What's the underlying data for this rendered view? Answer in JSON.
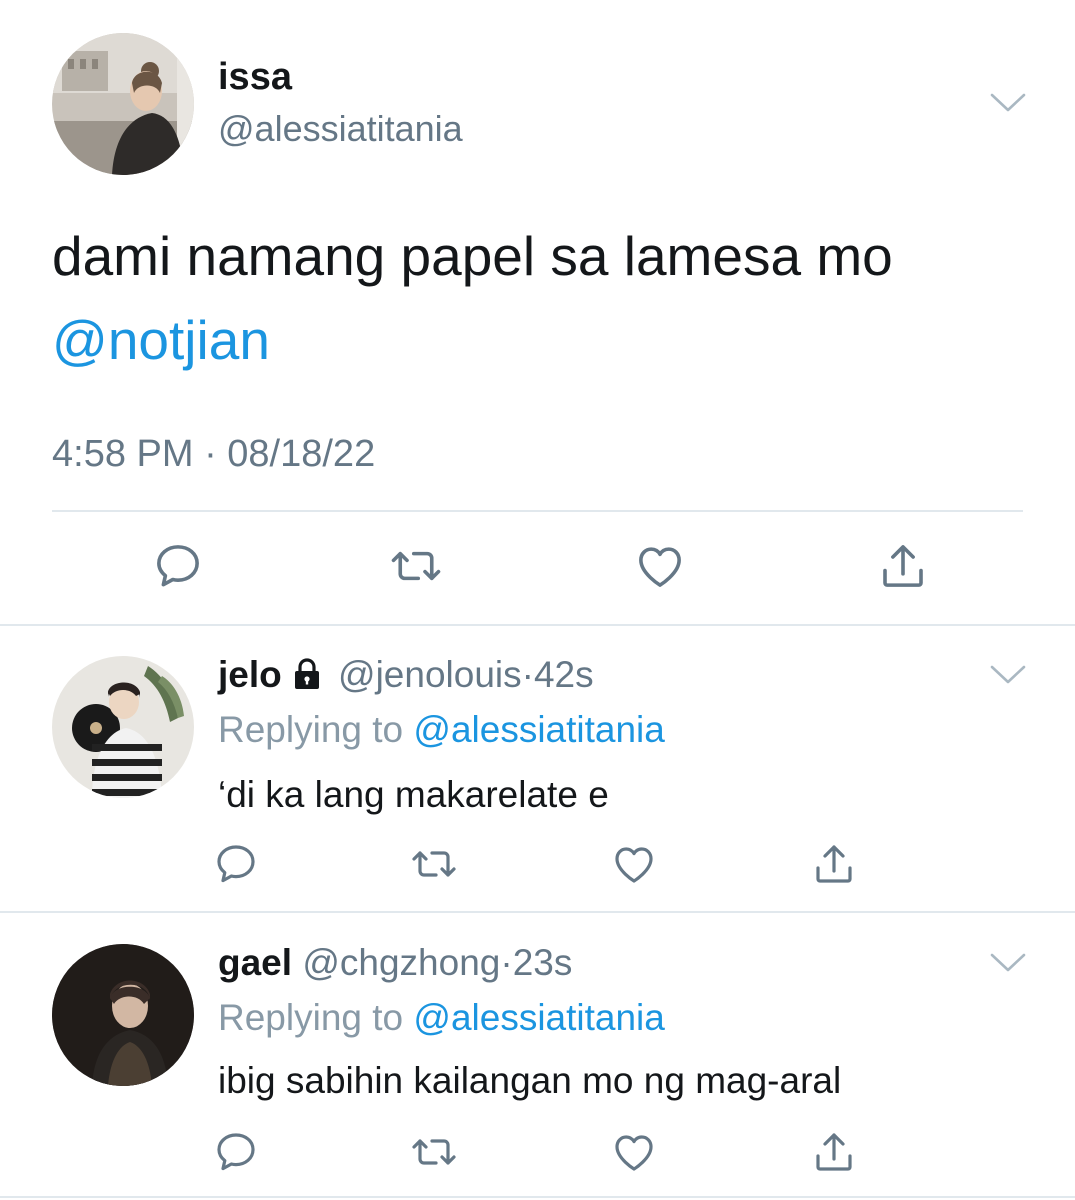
{
  "tweet": {
    "author": {
      "name": "issa",
      "handle": "@alessiatitania"
    },
    "text": "dami namang papel sa lamesa mo",
    "mention": "@notjian",
    "timestamp": "4:58 PM · 08/18/22"
  },
  "replies": [
    {
      "name": "jelo",
      "locked": true,
      "handle": "@jenolouis",
      "separator": "·",
      "time": "42s",
      "replying_prefix": "Replying to ",
      "replying_to": "@alessiatitania",
      "text": "‘di ka lang makarelate e"
    },
    {
      "name": "gael",
      "locked": false,
      "handle": "@chgzhong",
      "separator": "·",
      "time": "23s",
      "replying_prefix": "Replying to ",
      "replying_to": "@alessiatitania",
      "text": "ibig sabihin kailangan mo ng mag-aral"
    }
  ],
  "icons": {
    "reply": "reply-icon",
    "retweet": "retweet-icon",
    "like": "heart-icon",
    "share": "share-icon",
    "menu": "chevron-down-icon",
    "protected": "lock-icon"
  },
  "colors": {
    "text": "#14171a",
    "secondary": "#657786",
    "link": "#1b95e0",
    "divider": "#e1e8ed",
    "icon": "#657786"
  }
}
